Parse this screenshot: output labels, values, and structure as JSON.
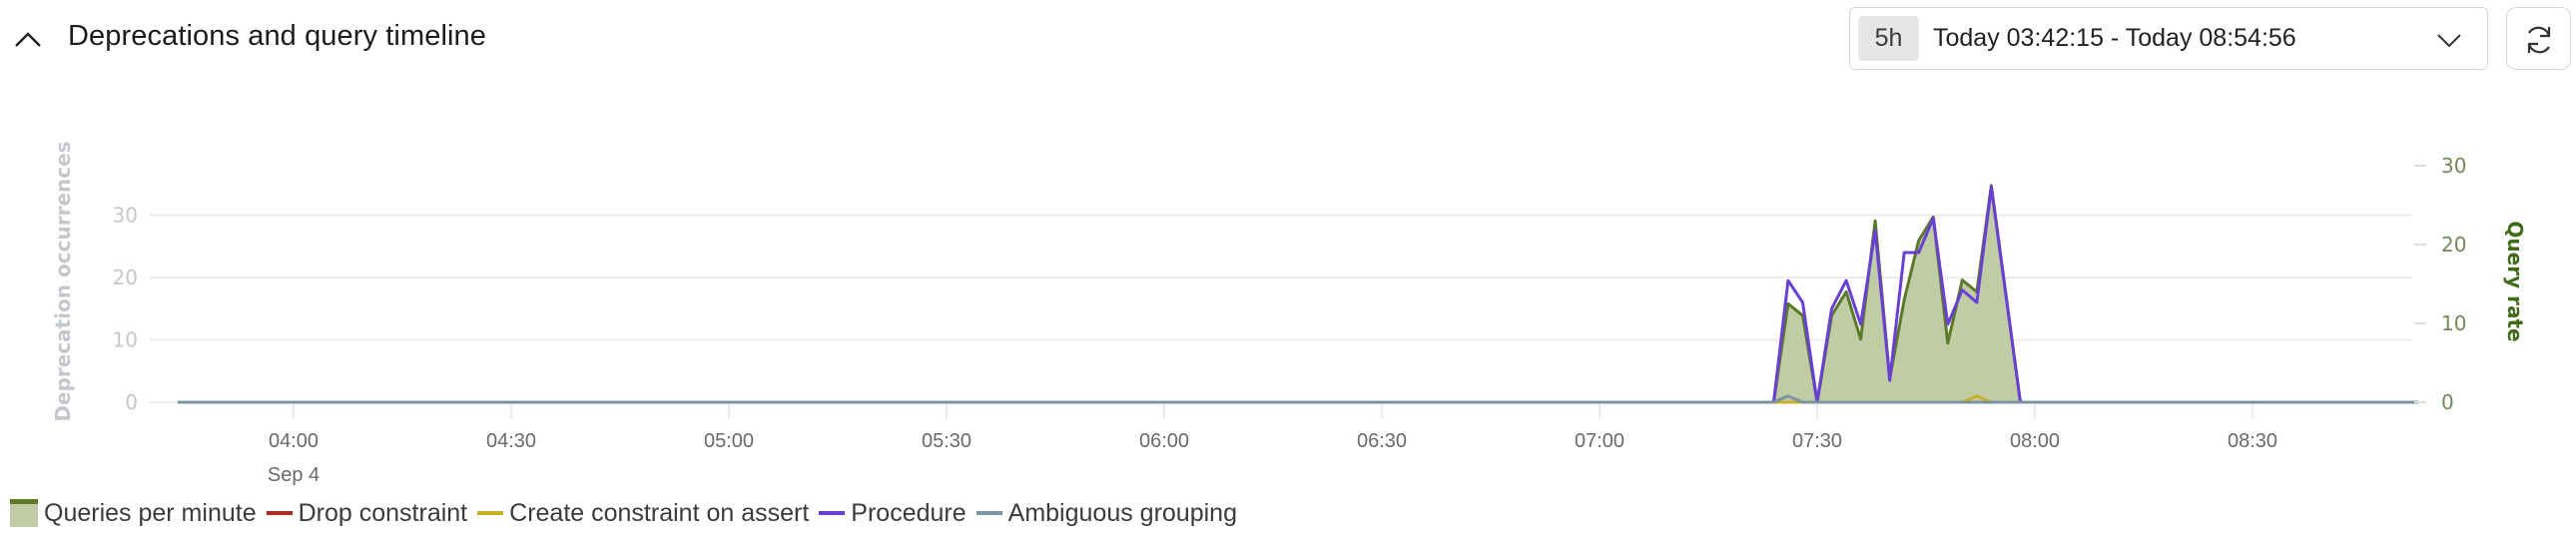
{
  "header": {
    "title": "Deprecations and query timeline",
    "collapse_icon": "chevron-up-icon",
    "range_badge": "5h",
    "range_text": "Today 03:42:15 - Today 08:54:56",
    "range_dropdown_icon": "chevron-down-icon",
    "refresh_icon": "refresh-icon"
  },
  "colors": {
    "queries_fill": "#c0cca4",
    "queries_line": "#5a7a2a",
    "drop_constraint": "#b0281e",
    "create_constraint": "#c9b02a",
    "procedure": "#6a3fd6",
    "ambiguous_grouping": "#7a94a4",
    "grid": "#ececec",
    "left_axis_text": "#c4c8cc",
    "right_axis_text": "#6f8a56",
    "right_axis_label": "#3f6a1a"
  },
  "chart_data": {
    "type": "area",
    "title": "Deprecations and query timeline",
    "x_axis": {
      "ticks": [
        "04:00",
        "04:30",
        "05:00",
        "05:30",
        "06:00",
        "06:30",
        "07:00",
        "07:30",
        "08:00",
        "08:30"
      ],
      "sub_label": "Sep 4",
      "range": [
        "03:42",
        "08:54"
      ]
    },
    "y_left": {
      "label": "Deprecation occurrences",
      "ticks": [
        0,
        10,
        20,
        30
      ],
      "range": [
        0,
        36
      ]
    },
    "y_right": {
      "label": "Query rate",
      "ticks": [
        0,
        10,
        20,
        30
      ],
      "range": [
        0,
        30
      ]
    },
    "grid": true,
    "legend_position": "bottom-left",
    "legend": [
      "Queries per minute",
      "Drop constraint",
      "Create constraint on assert",
      "Procedure",
      "Ambiguous grouping"
    ],
    "series": [
      {
        "name": "Queries per minute",
        "axis": "right",
        "kind": "area",
        "points": [
          [
            "03:42",
            0
          ],
          [
            "07:24",
            0
          ],
          [
            "07:26",
            12.5
          ],
          [
            "07:28",
            11
          ],
          [
            "07:30",
            0
          ],
          [
            "07:32",
            11
          ],
          [
            "07:34",
            14
          ],
          [
            "07:36",
            8
          ],
          [
            "07:38",
            23
          ],
          [
            "07:40",
            3
          ],
          [
            "07:42",
            13
          ],
          [
            "07:44",
            20.5
          ],
          [
            "07:46",
            23.5
          ],
          [
            "07:48",
            7.5
          ],
          [
            "07:50",
            15.5
          ],
          [
            "07:52",
            14
          ],
          [
            "07:54",
            27.5
          ],
          [
            "07:58",
            0
          ],
          [
            "08:54",
            0
          ]
        ]
      },
      {
        "name": "Drop constraint",
        "axis": "left",
        "kind": "line",
        "points": [
          [
            "03:42",
            0
          ],
          [
            "08:54",
            0
          ]
        ]
      },
      {
        "name": "Create constraint on assert",
        "axis": "left",
        "kind": "line",
        "points": [
          [
            "03:42",
            0
          ],
          [
            "07:50",
            0
          ],
          [
            "07:52",
            1
          ],
          [
            "07:54",
            0
          ],
          [
            "08:54",
            0
          ]
        ]
      },
      {
        "name": "Procedure",
        "axis": "left",
        "kind": "line",
        "points": [
          [
            "03:42",
            0
          ],
          [
            "07:24",
            0
          ],
          [
            "07:26",
            19.5
          ],
          [
            "07:28",
            16
          ],
          [
            "07:30",
            0
          ],
          [
            "07:32",
            15
          ],
          [
            "07:34",
            19.5
          ],
          [
            "07:36",
            12.5
          ],
          [
            "07:38",
            27.5
          ],
          [
            "07:40",
            3.5
          ],
          [
            "07:42",
            24
          ],
          [
            "07:44",
            24
          ],
          [
            "07:46",
            29.5
          ],
          [
            "07:48",
            12.5
          ],
          [
            "07:50",
            18
          ],
          [
            "07:52",
            16
          ],
          [
            "07:54",
            34.5
          ],
          [
            "07:58",
            0
          ],
          [
            "08:54",
            0
          ]
        ]
      },
      {
        "name": "Ambiguous grouping",
        "axis": "left",
        "kind": "line",
        "points": [
          [
            "03:42",
            0
          ],
          [
            "07:24",
            0
          ],
          [
            "07:26",
            1
          ],
          [
            "07:28",
            0
          ],
          [
            "08:54",
            0
          ]
        ]
      }
    ]
  }
}
